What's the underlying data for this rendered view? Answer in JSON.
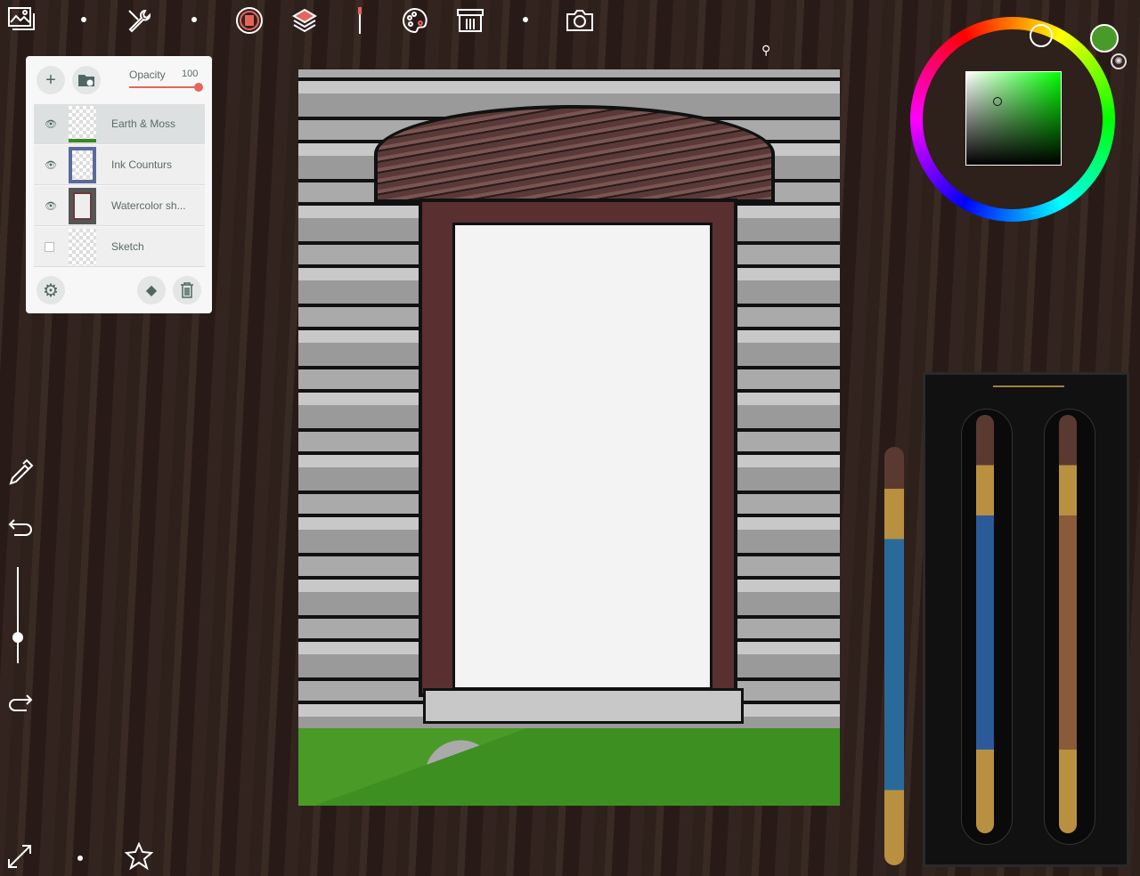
{
  "toolbar": {
    "items": [
      "gallery-icon",
      "tools-icon",
      "selection-icon",
      "layers-icon",
      "brush-icon",
      "palette-icon",
      "brush-library-icon",
      "camera-icon"
    ]
  },
  "layers_panel": {
    "opacity_label": "Opacity",
    "opacity_value": "100",
    "opacity_percent": 100,
    "layers": [
      {
        "name": "Earth & Moss",
        "visible": true,
        "selected": true
      },
      {
        "name": "Ink Counturs",
        "visible": true,
        "selected": false
      },
      {
        "name": "Watercolor sh...",
        "visible": true,
        "selected": false
      },
      {
        "name": "Sketch",
        "visible": false,
        "selected": false
      }
    ]
  },
  "colors": {
    "current": "#4a9a2a",
    "accent": "#e5645c"
  },
  "sidebar": {
    "items": [
      "eyedropper-icon",
      "undo-icon",
      "brush-size-slider",
      "redo-icon"
    ]
  },
  "bottom": {
    "items": [
      "fullscreen-icon",
      "favorites-icon"
    ]
  }
}
